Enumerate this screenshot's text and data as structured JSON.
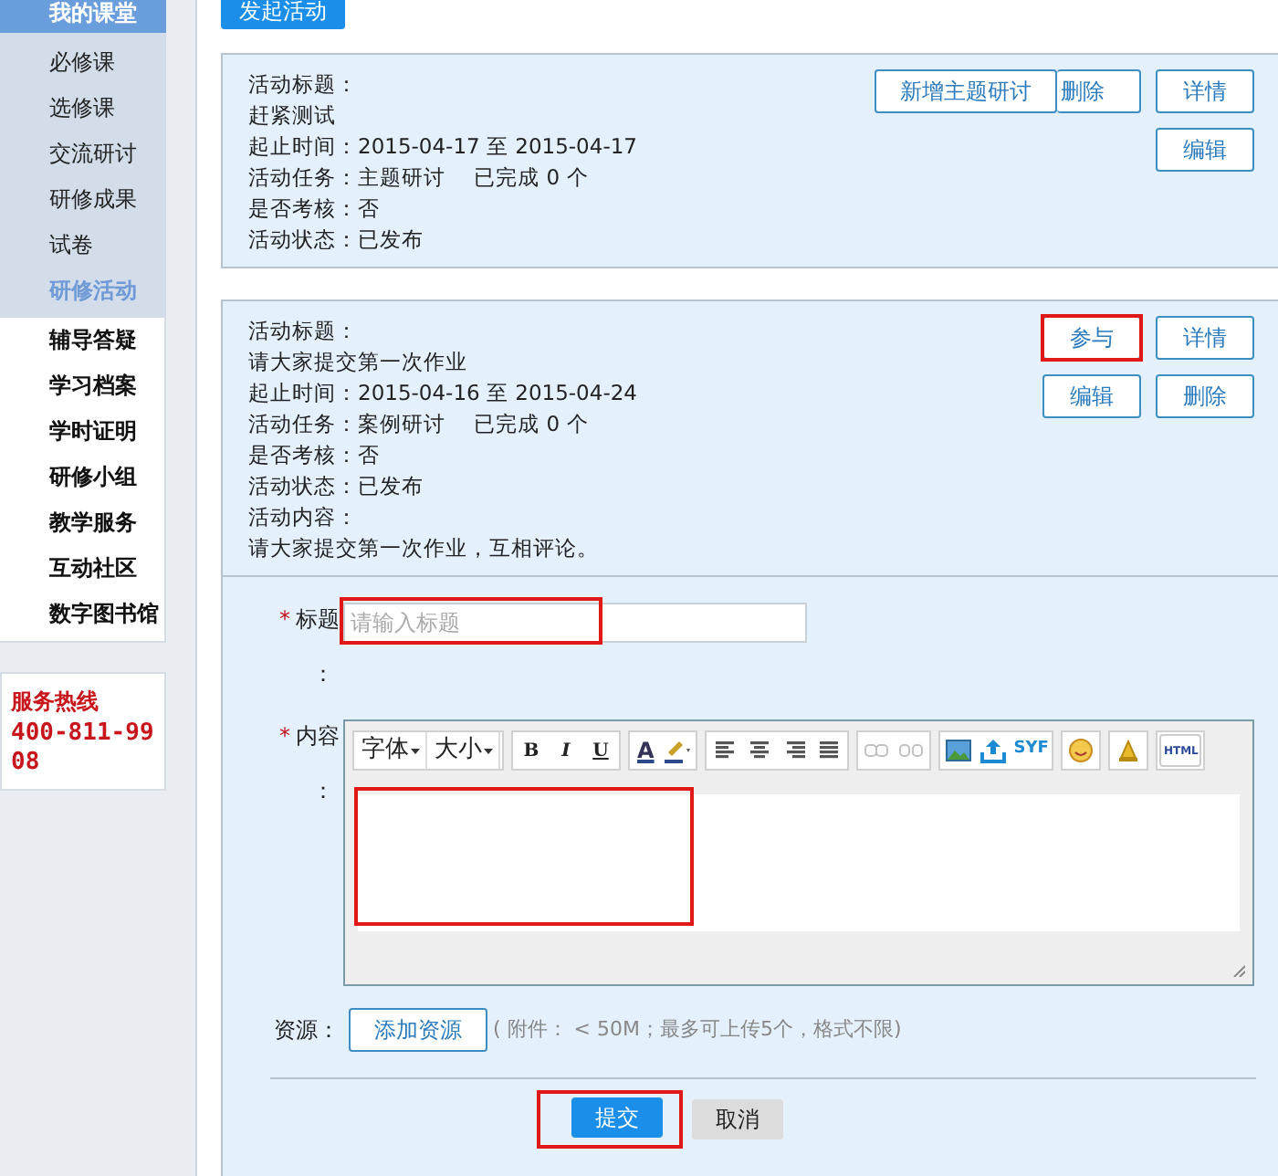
{
  "sidebar": {
    "header": {
      "label": "我的课堂"
    },
    "items": [
      {
        "label": "必修课",
        "kind": "sub",
        "selected": false
      },
      {
        "label": "选修课",
        "kind": "sub",
        "selected": false
      },
      {
        "label": "交流研讨",
        "kind": "sub",
        "selected": false
      },
      {
        "label": "研修成果",
        "kind": "sub",
        "selected": false
      },
      {
        "label": "试卷",
        "kind": "sub",
        "selected": false
      },
      {
        "label": "研修活动",
        "kind": "sub",
        "selected": true
      },
      {
        "label": "辅导答疑",
        "kind": "main",
        "selected": false
      },
      {
        "label": "学习档案",
        "kind": "main",
        "selected": false
      },
      {
        "label": "学时证明",
        "kind": "main",
        "selected": false
      },
      {
        "label": "研修小组",
        "kind": "main",
        "selected": false
      },
      {
        "label": "教学服务",
        "kind": "main",
        "selected": false
      },
      {
        "label": "互动社区",
        "kind": "main",
        "selected": false
      },
      {
        "label": "数字图书馆",
        "kind": "main",
        "selected": false
      }
    ],
    "hotline": {
      "label": "服务热线",
      "number": "400-811-9908"
    }
  },
  "start_button": "发起活动",
  "activities": [
    {
      "lines": [
        "活动标题：",
        "赶紧测试",
        "起止时间：2015-04-17 至 2015-04-17",
        "活动任务：主题研讨　 已完成 0 个",
        "是否考核：否",
        "活动状态：已发布"
      ],
      "overlay_button": "新增主题研讨",
      "buttons": [
        {
          "label": "删除",
          "highlighted": false
        },
        {
          "label": "详情",
          "highlighted": false
        },
        {
          "label": "编辑",
          "highlighted": false
        }
      ]
    },
    {
      "lines": [
        "活动标题：",
        "请大家提交第一次作业",
        "起止时间：2015-04-16 至 2015-04-24",
        "活动任务：案例研讨　 已完成 0 个",
        "是否考核：否",
        "活动状态：已发布",
        "活动内容：",
        "请大家提交第一次作业，互相评论。"
      ],
      "buttons": [
        {
          "label": "参与",
          "highlighted": true
        },
        {
          "label": "详情",
          "highlighted": false
        },
        {
          "label": "编辑",
          "highlighted": false
        },
        {
          "label": "删除",
          "highlighted": false
        }
      ]
    }
  ],
  "form": {
    "title_field": {
      "required_mark": "*",
      "label": "标题",
      "colon": "：",
      "placeholder": "请输入标题",
      "highlighted": true
    },
    "content_field": {
      "required_mark": "*",
      "label": "内容",
      "colon": "：",
      "highlighted": true,
      "toolbar": [
        {
          "kind": "dropdown",
          "label": "字体"
        },
        {
          "kind": "dropdown",
          "label": "大小"
        },
        {
          "kind": "bold",
          "label": "B"
        },
        {
          "kind": "italic",
          "label": "I"
        },
        {
          "kind": "underline",
          "label": "U"
        },
        {
          "kind": "color",
          "label": "A"
        },
        {
          "kind": "text_icon",
          "label": "SYF"
        },
        {
          "kind": "text_icon",
          "label": "HTML"
        }
      ]
    },
    "resource": {
      "label": "资源：",
      "button": "添加资源",
      "note": "( 附件： < 50M；最多可上传5个，格式不限)"
    },
    "submit": {
      "label": "提交",
      "highlighted": true
    },
    "cancel": "取消"
  }
}
